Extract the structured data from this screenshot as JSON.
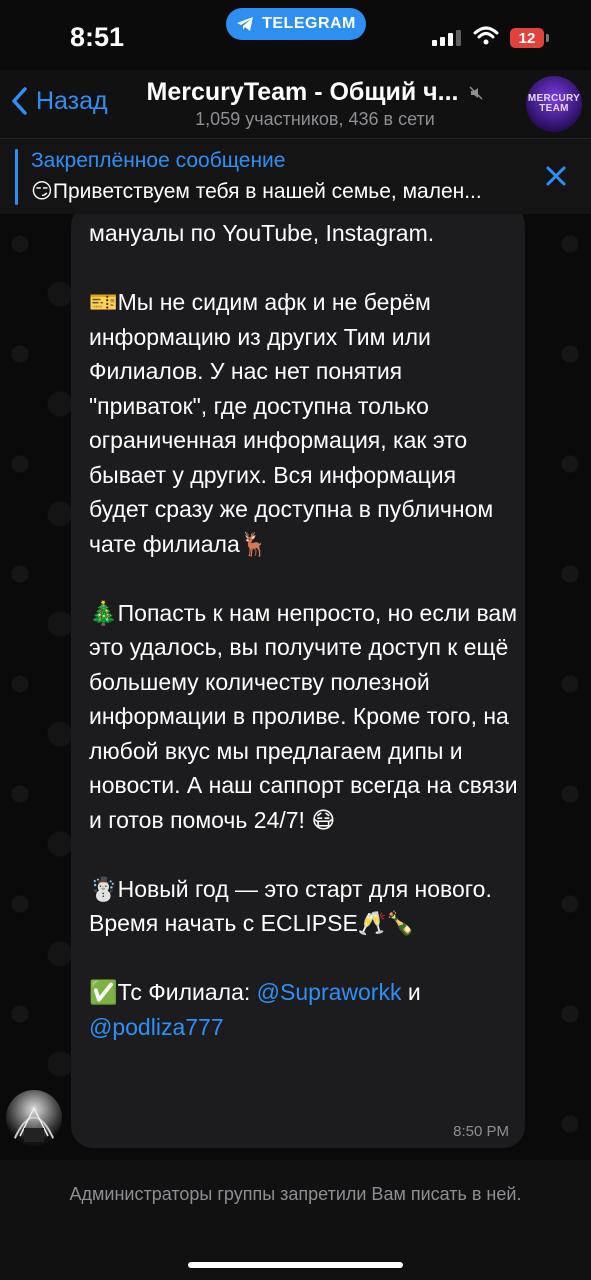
{
  "status_bar": {
    "time": "8:51",
    "telegram_label": "TELEGRAM",
    "battery": "12"
  },
  "header": {
    "back_label": "Назад",
    "title": "MercuryTeam - Общий ч...",
    "subtitle": "1,059 участников, 436 в сети",
    "avatar_text": "MERCURY TEAM"
  },
  "pinned": {
    "title": "Закреплённое сообщение",
    "preview": "😏Приветствуем тебя в нашей семье, мален..."
  },
  "message": {
    "p1": "мануалы по YouTube, Instagram.",
    "p2": "🎫Мы не сидим афк и не берём информацию из других Тим или Филиалов. У нас нет понятия \"приваток\", где доступна только ограниченная информация, как это бывает у других. Вся информация будет сразу же доступна в публичном чате филиала🦌",
    "p3": "🎄Попасть к нам непросто, но если вам это удалось, вы получите доступ к ещё большему количеству полезной информации в проливе. Кроме того, на любой вкус мы предлагаем дипы и новости. А наш саппорт всегда на связи и готов помочь 24/7! 😷",
    "p4": "☃️Новый год — это старт для нового. Время начать с ECLIPSE🥂🍾",
    "p5_prefix": "✅Тс Филиала: ",
    "link1": "@Supraworkk",
    "p5_mid": " и ",
    "link2": "@podliza777",
    "time": "8:50 PM"
  },
  "footer": {
    "notice": "Администраторы группы запретили Вам писать в ней."
  },
  "colors": {
    "accent": "#2e90f6",
    "bubble": "#1c1c1e",
    "background": "#0a0a0b"
  }
}
